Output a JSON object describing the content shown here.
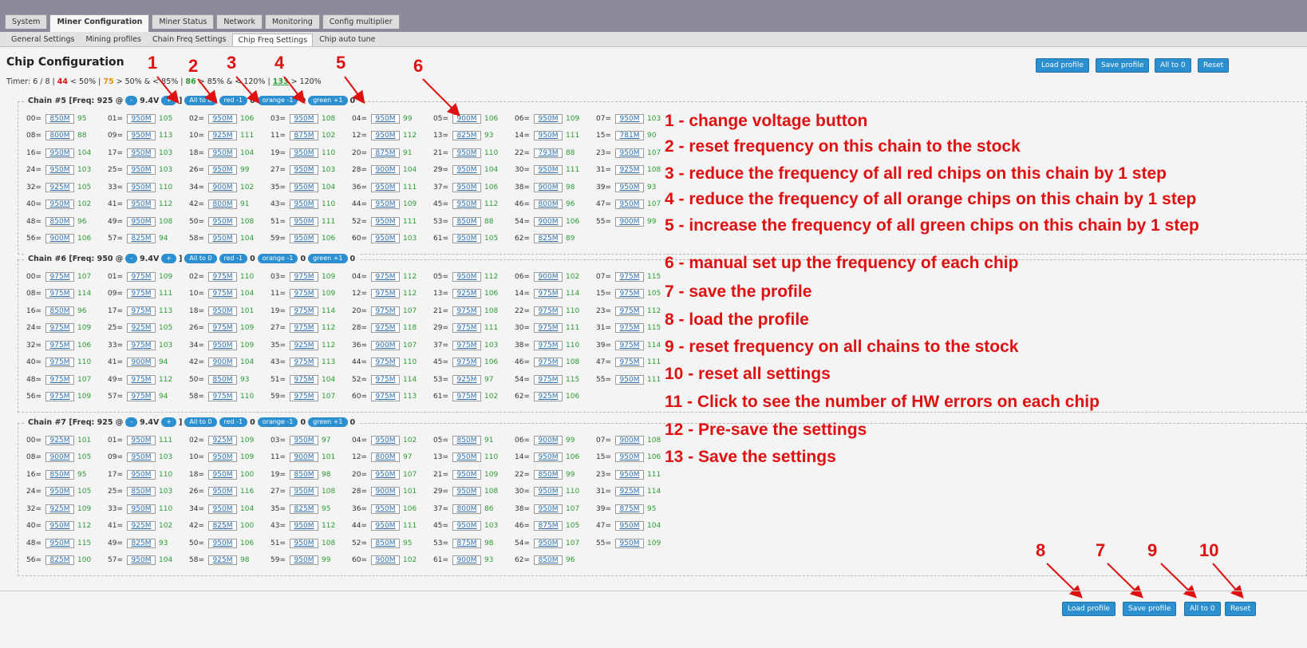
{
  "tabs": [
    "System",
    "Miner Configuration",
    "Miner Status",
    "Network",
    "Monitoring",
    "Config multiplier"
  ],
  "subtabs": [
    "General Settings",
    "Mining profiles",
    "Chain Freq Settings",
    "Chip Freq Settings",
    "Chip auto tune"
  ],
  "page_title": "Chip Configuration",
  "buttons": {
    "load": "Load profile",
    "save": "Save profile",
    "all0": "All to 0",
    "reset": "Reset"
  },
  "timer": {
    "prefix": "Timer: 6 / 8 | ",
    "red_n": "44",
    "red_t": " < 50% | ",
    "orange_n": "75",
    "orange_t": " > 50% & < 85% | ",
    "green_n": "86",
    "green_t": " > 85% & < 120% | ",
    "blue_n": "133",
    "blue_t": " > 120%"
  },
  "chain_controls": {
    "minus": "-",
    "plus": "+",
    "all0": "All to 0",
    "red": "red -1",
    "orange": "orange -1",
    "green": "green +1",
    "zero": "0"
  },
  "chains": [
    {
      "name": "Chain #5 [Freq: 925 @",
      "volt": "9.4V",
      "rows": [
        [
          "00=",
          "850M",
          "95",
          "01=",
          "950M",
          "105",
          "02=",
          "950M",
          "106",
          "03=",
          "950M",
          "108",
          "04=",
          "950M",
          "99",
          "05=",
          "900M",
          "106",
          "06=",
          "950M",
          "109",
          "07=",
          "950M",
          "103"
        ],
        [
          "08=",
          "800M",
          "88",
          "09=",
          "950M",
          "113",
          "10=",
          "925M",
          "111",
          "11=",
          "875M",
          "102",
          "12=",
          "950M",
          "112",
          "13=",
          "825M",
          "93",
          "14=",
          "950M",
          "111",
          "15=",
          "781M",
          "90"
        ],
        [
          "16=",
          "950M",
          "104",
          "17=",
          "950M",
          "103",
          "18=",
          "950M",
          "104",
          "19=",
          "950M",
          "110",
          "20=",
          "875M",
          "91",
          "21=",
          "950M",
          "110",
          "22=",
          "793M",
          "88",
          "23=",
          "950M",
          "107"
        ],
        [
          "24=",
          "950M",
          "103",
          "25=",
          "950M",
          "103",
          "26=",
          "950M",
          "99",
          "27=",
          "950M",
          "103",
          "28=",
          "900M",
          "104",
          "29=",
          "950M",
          "104",
          "30=",
          "950M",
          "111",
          "31=",
          "925M",
          "108"
        ],
        [
          "32=",
          "925M",
          "105",
          "33=",
          "950M",
          "110",
          "34=",
          "900M",
          "102",
          "35=",
          "950M",
          "104",
          "36=",
          "950M",
          "111",
          "37=",
          "950M",
          "106",
          "38=",
          "900M",
          "98",
          "39=",
          "950M",
          "93"
        ],
        [
          "40=",
          "950M",
          "102",
          "41=",
          "950M",
          "112",
          "42=",
          "800M",
          "91",
          "43=",
          "950M",
          "110",
          "44=",
          "950M",
          "109",
          "45=",
          "950M",
          "112",
          "46=",
          "800M",
          "96",
          "47=",
          "950M",
          "107"
        ],
        [
          "48=",
          "850M",
          "96",
          "49=",
          "950M",
          "108",
          "50=",
          "950M",
          "108",
          "51=",
          "950M",
          "111",
          "52=",
          "950M",
          "111",
          "53=",
          "850M",
          "88",
          "54=",
          "900M",
          "106",
          "55=",
          "900M",
          "99"
        ],
        [
          "56=",
          "900M",
          "106",
          "57=",
          "825M",
          "94",
          "58=",
          "950M",
          "104",
          "59=",
          "950M",
          "106",
          "60=",
          "950M",
          "103",
          "61=",
          "950M",
          "105",
          "62=",
          "825M",
          "89"
        ]
      ]
    },
    {
      "name": "Chain #6 [Freq: 950 @",
      "volt": "9.4V",
      "rows": [
        [
          "00=",
          "975M",
          "107",
          "01=",
          "975M",
          "109",
          "02=",
          "975M",
          "110",
          "03=",
          "975M",
          "109",
          "04=",
          "975M",
          "112",
          "05=",
          "950M",
          "112",
          "06=",
          "900M",
          "102",
          "07=",
          "975M",
          "115"
        ],
        [
          "08=",
          "975M",
          "114",
          "09=",
          "975M",
          "111",
          "10=",
          "975M",
          "104",
          "11=",
          "975M",
          "109",
          "12=",
          "975M",
          "112",
          "13=",
          "925M",
          "106",
          "14=",
          "975M",
          "114",
          "15=",
          "975M",
          "105"
        ],
        [
          "16=",
          "850M",
          "96",
          "17=",
          "975M",
          "113",
          "18=",
          "950M",
          "101",
          "19=",
          "975M",
          "114",
          "20=",
          "975M",
          "107",
          "21=",
          "975M",
          "108",
          "22=",
          "975M",
          "110",
          "23=",
          "975M",
          "112"
        ],
        [
          "24=",
          "975M",
          "109",
          "25=",
          "925M",
          "105",
          "26=",
          "975M",
          "109",
          "27=",
          "975M",
          "112",
          "28=",
          "975M",
          "118",
          "29=",
          "975M",
          "111",
          "30=",
          "975M",
          "111",
          "31=",
          "975M",
          "115"
        ],
        [
          "32=",
          "975M",
          "106",
          "33=",
          "975M",
          "103",
          "34=",
          "950M",
          "109",
          "35=",
          "925M",
          "112",
          "36=",
          "900M",
          "107",
          "37=",
          "975M",
          "103",
          "38=",
          "975M",
          "110",
          "39=",
          "975M",
          "114"
        ],
        [
          "40=",
          "975M",
          "110",
          "41=",
          "900M",
          "94",
          "42=",
          "900M",
          "104",
          "43=",
          "975M",
          "113",
          "44=",
          "975M",
          "110",
          "45=",
          "975M",
          "106",
          "46=",
          "975M",
          "108",
          "47=",
          "975M",
          "111"
        ],
        [
          "48=",
          "975M",
          "107",
          "49=",
          "975M",
          "112",
          "50=",
          "850M",
          "93",
          "51=",
          "975M",
          "104",
          "52=",
          "975M",
          "114",
          "53=",
          "925M",
          "97",
          "54=",
          "975M",
          "115",
          "55=",
          "950M",
          "111"
        ],
        [
          "56=",
          "975M",
          "109",
          "57=",
          "975M",
          "94",
          "58=",
          "975M",
          "110",
          "59=",
          "975M",
          "107",
          "60=",
          "975M",
          "113",
          "61=",
          "975M",
          "102",
          "62=",
          "925M",
          "106"
        ]
      ]
    },
    {
      "name": "Chain #7 [Freq: 925 @",
      "volt": "9.4V",
      "rows": [
        [
          "00=",
          "925M",
          "101",
          "01=",
          "950M",
          "111",
          "02=",
          "925M",
          "109",
          "03=",
          "950M",
          "97",
          "04=",
          "950M",
          "102",
          "05=",
          "850M",
          "91",
          "06=",
          "900M",
          "99",
          "07=",
          "900M",
          "108"
        ],
        [
          "08=",
          "900M",
          "105",
          "09=",
          "950M",
          "103",
          "10=",
          "950M",
          "109",
          "11=",
          "900M",
          "101",
          "12=",
          "800M",
          "97",
          "13=",
          "950M",
          "110",
          "14=",
          "950M",
          "106",
          "15=",
          "950M",
          "106"
        ],
        [
          "16=",
          "850M",
          "95",
          "17=",
          "950M",
          "110",
          "18=",
          "950M",
          "100",
          "19=",
          "850M",
          "98",
          "20=",
          "950M",
          "107",
          "21=",
          "950M",
          "109",
          "22=",
          "850M",
          "99",
          "23=",
          "950M",
          "111"
        ],
        [
          "24=",
          "950M",
          "105",
          "25=",
          "850M",
          "103",
          "26=",
          "950M",
          "116",
          "27=",
          "950M",
          "108",
          "28=",
          "900M",
          "101",
          "29=",
          "950M",
          "108",
          "30=",
          "950M",
          "110",
          "31=",
          "925M",
          "114"
        ],
        [
          "32=",
          "925M",
          "109",
          "33=",
          "950M",
          "110",
          "34=",
          "950M",
          "104",
          "35=",
          "825M",
          "95",
          "36=",
          "950M",
          "106",
          "37=",
          "800M",
          "86",
          "38=",
          "950M",
          "107",
          "39=",
          "875M",
          "95"
        ],
        [
          "40=",
          "950M",
          "112",
          "41=",
          "925M",
          "102",
          "42=",
          "825M",
          "100",
          "43=",
          "950M",
          "112",
          "44=",
          "950M",
          "111",
          "45=",
          "950M",
          "103",
          "46=",
          "875M",
          "105",
          "47=",
          "950M",
          "104"
        ],
        [
          "48=",
          "950M",
          "115",
          "49=",
          "825M",
          "93",
          "50=",
          "950M",
          "106",
          "51=",
          "950M",
          "108",
          "52=",
          "850M",
          "95",
          "53=",
          "875M",
          "98",
          "54=",
          "950M",
          "107",
          "55=",
          "950M",
          "109"
        ],
        [
          "56=",
          "825M",
          "100",
          "57=",
          "950M",
          "104",
          "58=",
          "925M",
          "98",
          "59=",
          "950M",
          "99",
          "60=",
          "900M",
          "102",
          "61=",
          "900M",
          "93",
          "62=",
          "850M",
          "96"
        ]
      ]
    }
  ],
  "notes": [
    "1 - change voltage button",
    "2 - reset frequency on this chain to the stock",
    "3 - reduce the frequency of all red chips on this chain by 1 step",
    "4 - reduce the frequency of all orange chips on this chain by 1 step",
    "5 - increase the frequency of all green chips on this chain by 1 step",
    "6 - manual set up the frequency of each chip",
    "7 - save the profile",
    "8 - load the profile",
    "9 - reset frequency on all chains to the stock",
    "10 - reset all settings",
    "11 - Click to see the number of HW errors on each chip",
    "12 - Pre-save the settings",
    "13 - Save the settings"
  ],
  "markers_top": [
    "1",
    "2",
    "3",
    "4",
    "5",
    "6"
  ],
  "markers_bottom": [
    "8",
    "7",
    "9",
    "10"
  ],
  "colors": {
    "accent": "#2b8fd0",
    "annotation": "#e01010",
    "good": "#2c9c34"
  }
}
